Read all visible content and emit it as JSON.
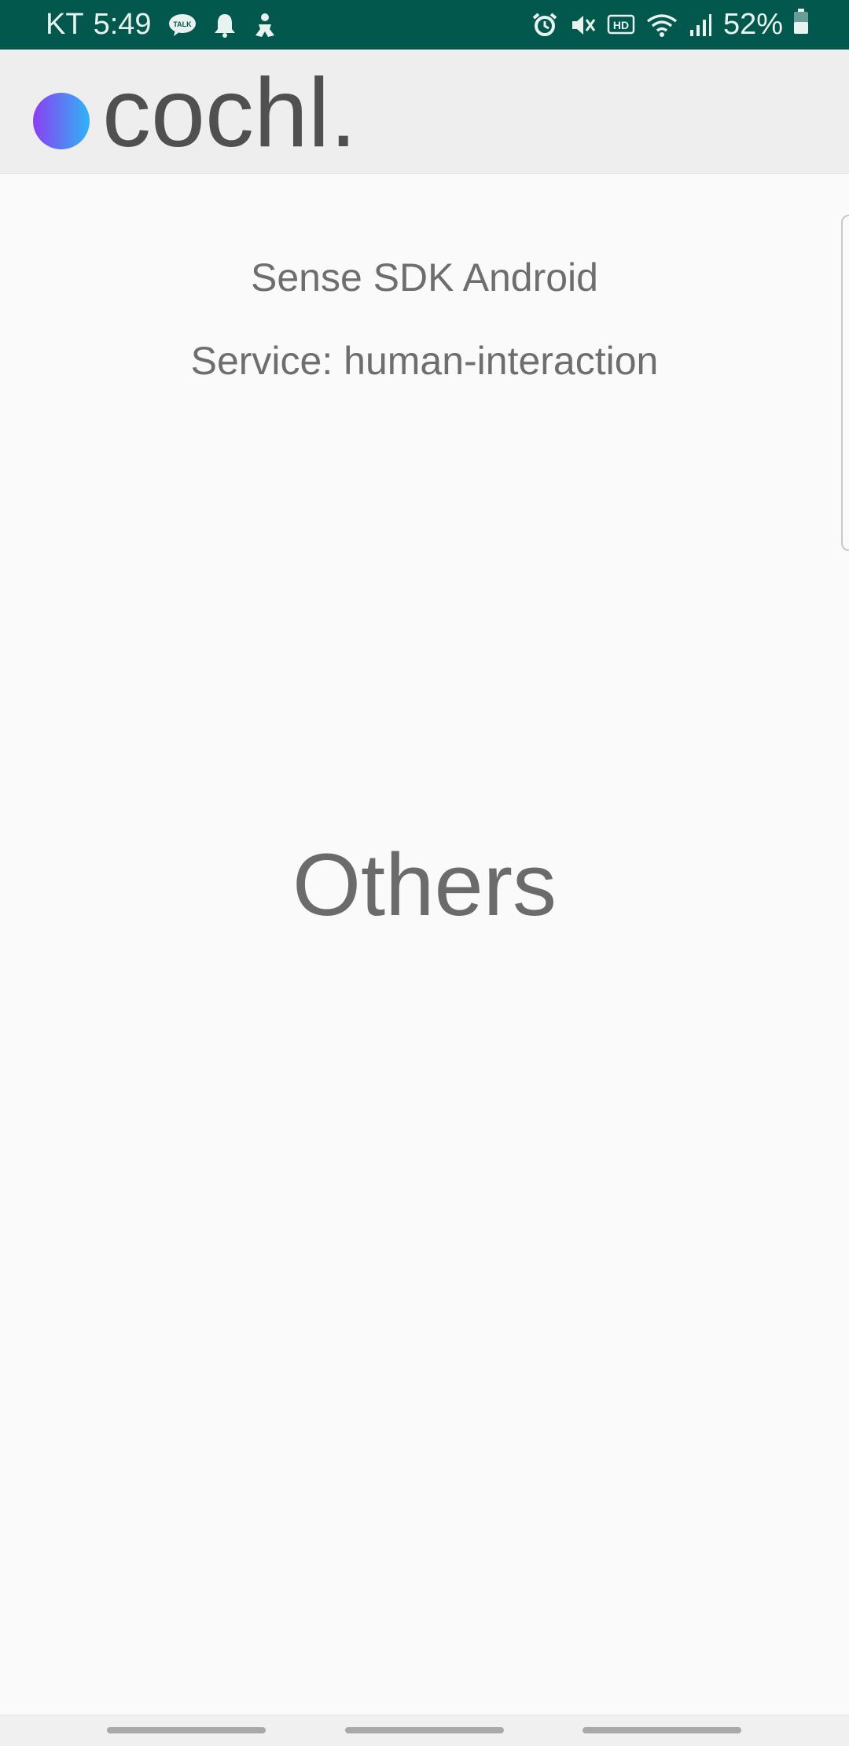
{
  "status_bar": {
    "carrier": "KT",
    "time": "5:49",
    "battery_percent": "52%",
    "notification_icons": [
      "kakaotalk-icon",
      "bell-icon",
      "person-icon"
    ],
    "system_icons": [
      "alarm-icon",
      "vibrate-icon",
      "hd-icon",
      "wifi-icon",
      "signal-icon",
      "battery-icon"
    ],
    "background_color": "#02584d"
  },
  "app_bar": {
    "logo_text": "cochl."
  },
  "main": {
    "sdk_title": "Sense SDK Android",
    "service_label": "Service: human-interaction",
    "result_label": "Others"
  },
  "nav_bar": {
    "buttons": [
      "recent-apps",
      "home",
      "back"
    ]
  }
}
